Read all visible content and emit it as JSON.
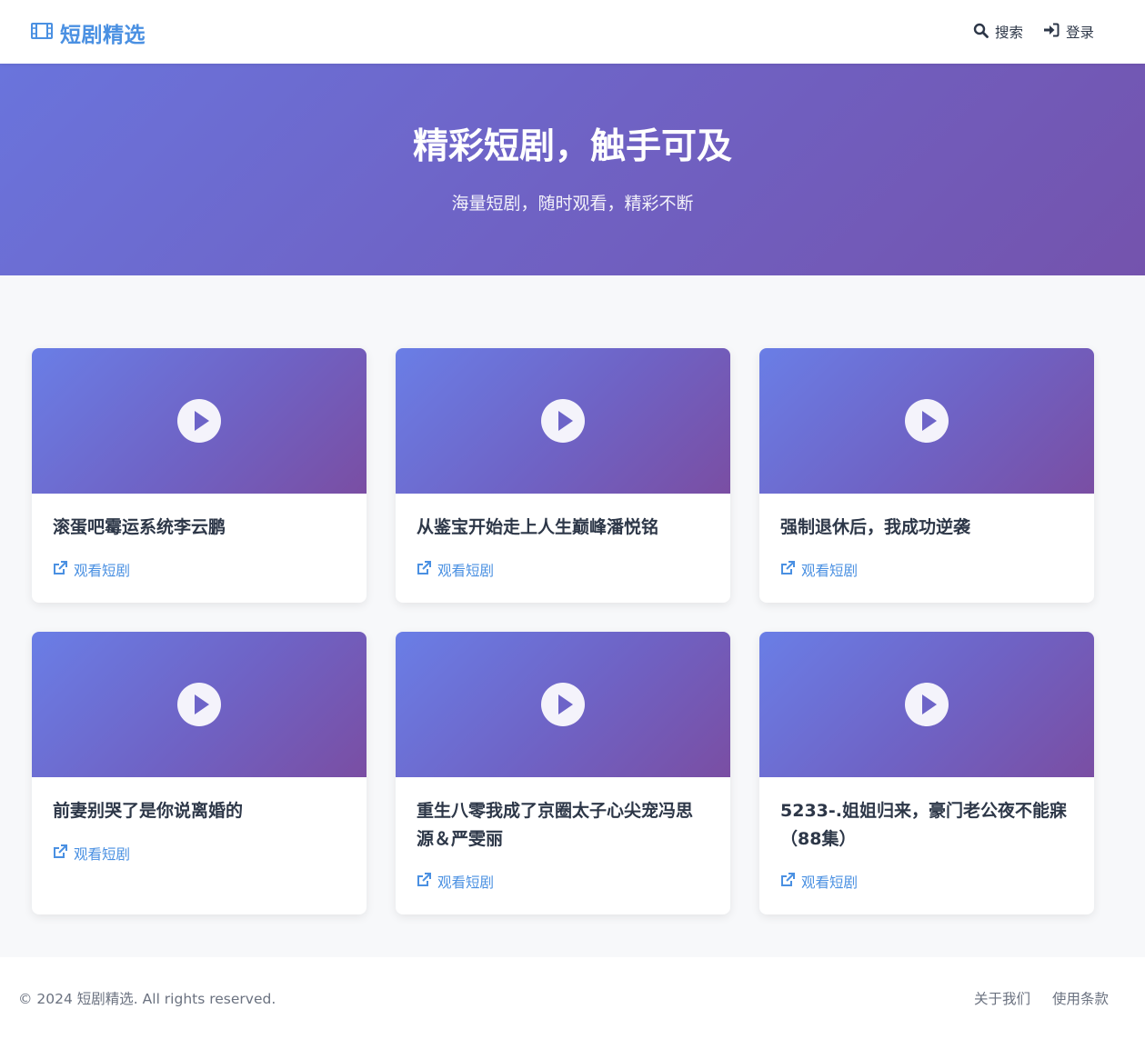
{
  "header": {
    "logo_text": "短剧精选",
    "nav": [
      {
        "label": "搜索",
        "icon": "search-icon"
      },
      {
        "label": "登录",
        "icon": "sign-in-icon"
      }
    ]
  },
  "hero": {
    "title": "精彩短剧，触手可及",
    "subtitle": "海量短剧，随时观看，精彩不断"
  },
  "cards": [
    {
      "title": "滚蛋吧霉运系统李云鹏",
      "action": "观看短剧"
    },
    {
      "title": "从鉴宝开始走上人生巅峰潘悦铭",
      "action": "观看短剧"
    },
    {
      "title": "强制退休后，我成功逆袭",
      "action": "观看短剧"
    },
    {
      "title": "前妻别哭了是你说离婚的",
      "action": "观看短剧"
    },
    {
      "title": "重生八零我成了京圈太子心尖宠冯思源＆严雯丽",
      "action": "观看短剧"
    },
    {
      "title": "5233-.姐姐归来，豪门老公夜不能寐（88集）",
      "action": "观看短剧"
    }
  ],
  "footer": {
    "copyright": "© 2024 短剧精选. All rights reserved.",
    "links": [
      "关于我们",
      "使用条款"
    ]
  },
  "colors": {
    "brand": "#4a90e2",
    "hero_gradient_start": "#6a74dc",
    "hero_gradient_end": "#7453ad"
  }
}
